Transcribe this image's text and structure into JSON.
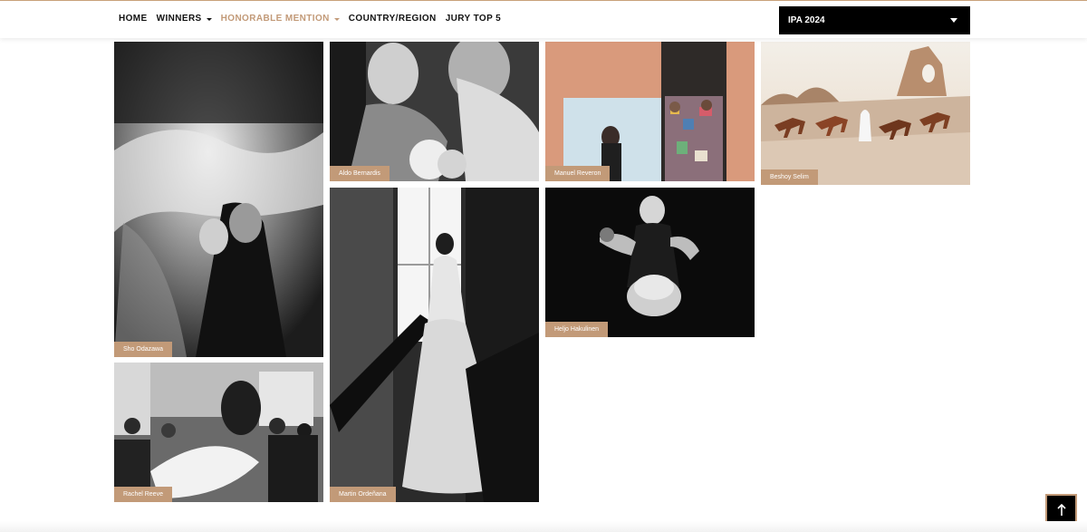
{
  "nav": {
    "items": [
      {
        "label": "HOME"
      },
      {
        "label": "WINNERS"
      },
      {
        "label": "HONORABLE MENTION"
      },
      {
        "label": "COUNTRY/REGION"
      },
      {
        "label": "JURY TOP 5"
      }
    ],
    "active_color": "#c29a78"
  },
  "year_select": {
    "value": "IPA 2024"
  },
  "gallery": {
    "photos": [
      {
        "credit": "Sho Odazawa"
      },
      {
        "credit": "Rachel Reeve"
      },
      {
        "credit": "Aldo Bernardis"
      },
      {
        "credit": "Martin Ordeñana"
      },
      {
        "credit": "Manuel Reveron"
      },
      {
        "credit": "Heljo Hakulinen"
      },
      {
        "credit": "Beshoy Selim"
      }
    ],
    "tag_color": "#c29a78"
  },
  "back_to_top": {
    "icon": "arrow-up-icon"
  }
}
